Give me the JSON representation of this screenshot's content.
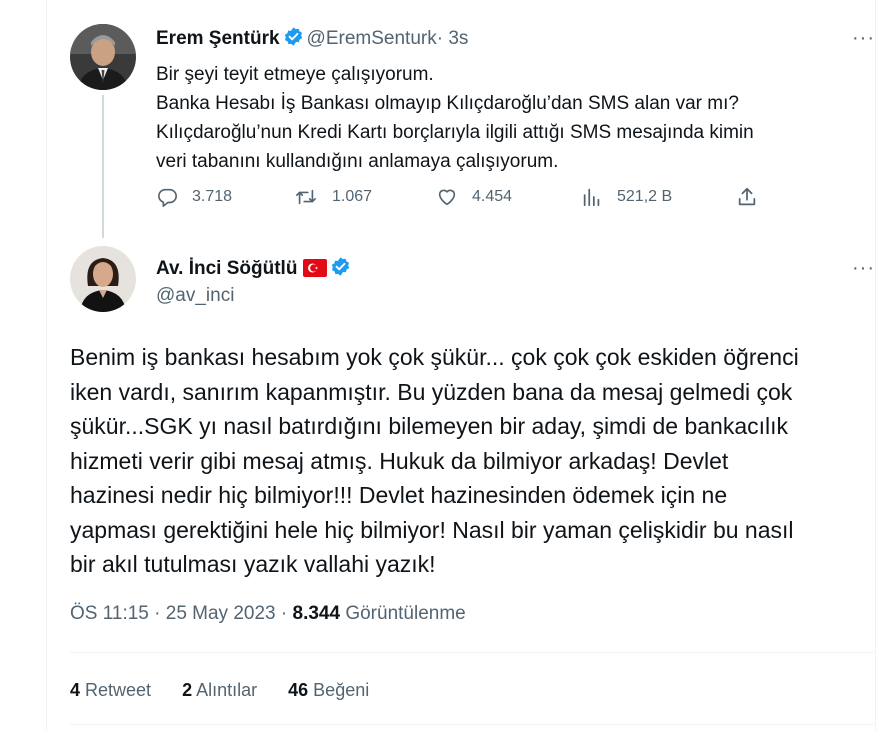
{
  "tweet1": {
    "author_name": "Erem Şentürk",
    "author_handle": "@EremSenturk",
    "time": "· 3s",
    "more": "···",
    "lines": [
      "Bir şeyi teyit etmeye çalışıyorum.",
      "Banka Hesabı İş Bankası olmayıp Kılıçdaroğlu’dan SMS alan var mı?",
      "Kılıçdaroğlu’nun Kredi Kartı borçlarıyla ilgili attığı SMS mesajında kimin",
      "veri tabanını kullandığını anlamaya çalışıyorum."
    ],
    "actions": {
      "replies": "3.718",
      "retweets": "1.067",
      "likes": "4.454",
      "views": "521,2 B"
    }
  },
  "tweet2": {
    "author_name": "Av. İnci Söğütlü",
    "author_handle": "@av_inci",
    "more": "···",
    "lines": [
      "Benim iş bankası hesabım yok çok şükür... çok çok çok eskiden öğrenci",
      "iken vardı, sanırım kapanmıştır. Bu yüzden bana da mesaj gelmedi çok",
      "şükür...SGK yı nasıl batırdığını bilemeyen bir aday, şimdi de bankacılık",
      "hizmeti verir gibi mesaj atmış. Hukuk da bilmiyor arkadaş! Devlet",
      "hazinesi nedir hiç bilmiyor!!! Devlet hazinesinden ödemek için ne",
      "yapması gerektiğini hele hiç bilmiyor! Nasıl bir yaman çelişkidir bu nasıl",
      "bir akıl tutulması yazık vallahi yazık!"
    ],
    "timestamp": "ÖS 11:15 · 25 May 2023 · ",
    "view_count": "8.344",
    "view_label": " Görüntülenme",
    "stats": {
      "retweets_count": "4",
      "retweets_label": " Retweet",
      "quotes_count": "2",
      "quotes_label": " Alıntılar",
      "likes_count": "46",
      "likes_label": " Beğeni"
    }
  },
  "colors": {
    "verified": "#1d9bf0",
    "muted": "#536471",
    "text": "#0f1419",
    "flag_red": "#e30a17"
  }
}
